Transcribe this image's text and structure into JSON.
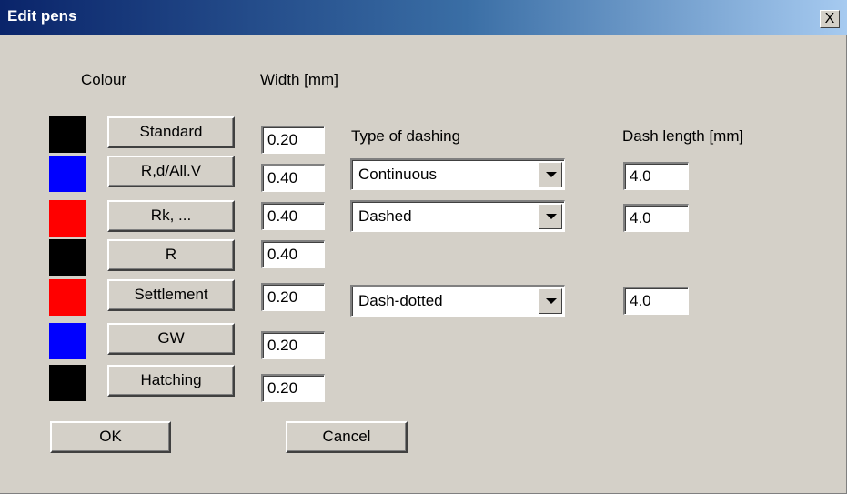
{
  "window": {
    "title": "Edit pens",
    "close_label": "X"
  },
  "headers": {
    "colour": "Colour",
    "width": "Width [mm]",
    "type_of_dashing": "Type of dashing",
    "dash_length": "Dash length [mm]"
  },
  "pens": [
    {
      "color": "#000000",
      "name": "Standard",
      "width": "0.20"
    },
    {
      "color": "#0000ff",
      "name": "R,d/All.V",
      "width": "0.40",
      "dashing": "Continuous",
      "dash_length": "4.0"
    },
    {
      "color": "#ff0000",
      "name": "Rk, ...",
      "width": "0.40",
      "dashing": "Dashed",
      "dash_length": "4.0"
    },
    {
      "color": "#000000",
      "name": "R",
      "width": "0.40"
    },
    {
      "color": "#ff0000",
      "name": "Settlement",
      "width": "0.20",
      "dashing": "Dash-dotted",
      "dash_length": "4.0"
    },
    {
      "color": "#0000ff",
      "name": "GW",
      "width": "0.20"
    },
    {
      "color": "#000000",
      "name": "Hatching",
      "width": "0.20"
    }
  ],
  "buttons": {
    "ok": "OK",
    "cancel": "Cancel"
  },
  "icons": {
    "dropdown": "chevron-down-icon",
    "close": "close-icon"
  }
}
